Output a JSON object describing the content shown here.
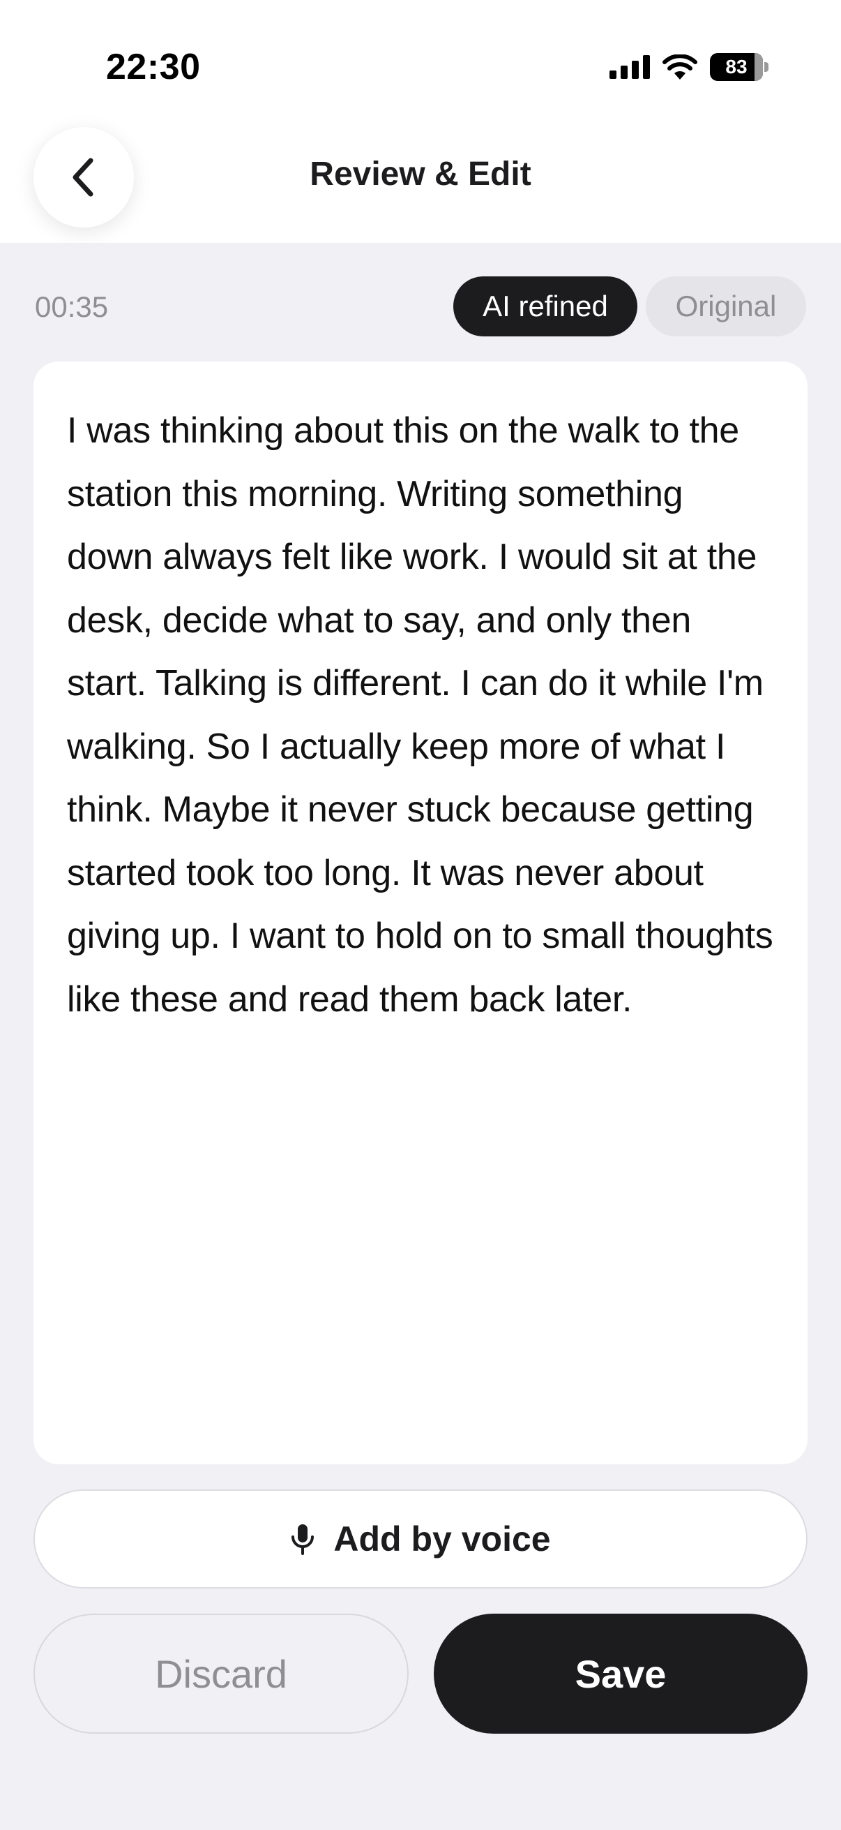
{
  "status_bar": {
    "time": "22:30",
    "battery_level": "83",
    "icons": [
      "cellular-signal-icon",
      "wifi-icon",
      "battery-icon"
    ]
  },
  "header": {
    "back_icon": "chevron-left-icon",
    "title": "Review & Edit"
  },
  "recording": {
    "duration": "00:35"
  },
  "view_toggle": {
    "options": [
      {
        "label": "AI refined",
        "selected": true
      },
      {
        "label": "Original",
        "selected": false
      }
    ]
  },
  "transcript": {
    "text": "I was thinking about this on the walk to the station this morning. Writing something down always felt like work. I would sit at the desk, decide what to say, and only then start. Talking is different. I can do it while I'm walking. So I actually keep more of what I think. Maybe it never stuck because getting started took too long. It was never about giving up. I want to hold on to small thoughts like these and read them back later."
  },
  "actions": {
    "add_voice_label": "Add by voice",
    "add_voice_icon": "microphone-icon",
    "discard_label": "Discard",
    "save_label": "Save"
  },
  "colors": {
    "background": "#f1f0f5",
    "surface": "#ffffff",
    "primary": "#1c1c1e",
    "muted_text": "#8e8e93",
    "inactive_chip": "#e4e4e9"
  }
}
